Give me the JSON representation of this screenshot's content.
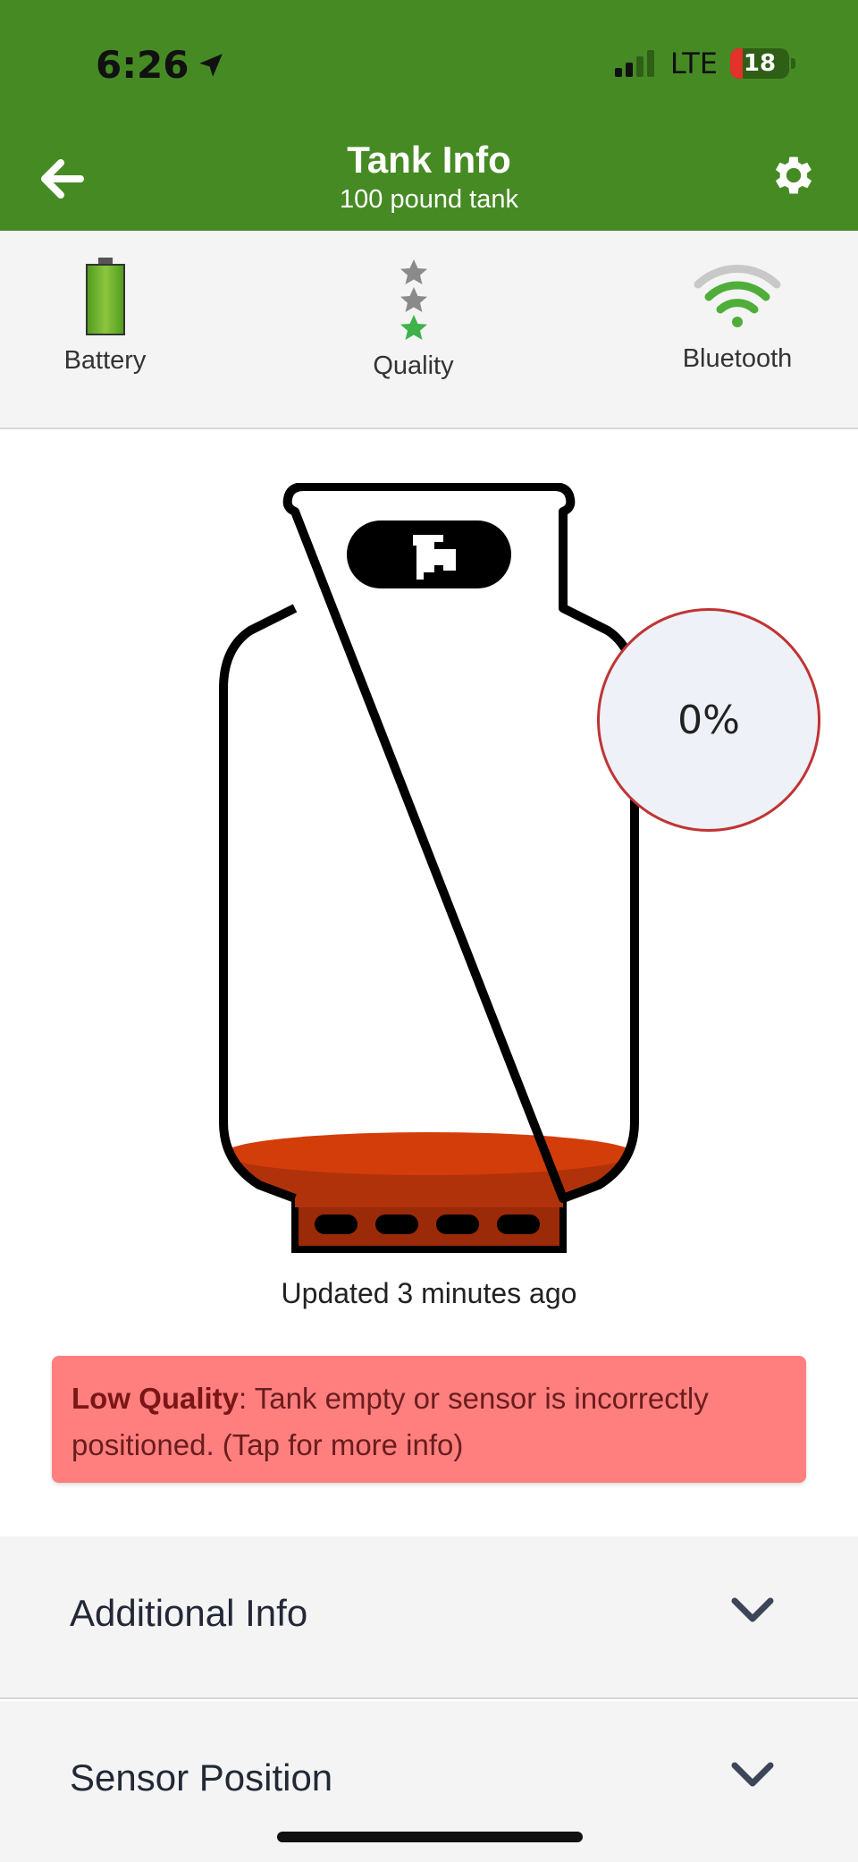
{
  "status_bar": {
    "time": "6:26",
    "network": "LTE",
    "battery_level": "18"
  },
  "header": {
    "title": "Tank Info",
    "subtitle": "100 pound tank"
  },
  "stats": {
    "battery_label": "Battery",
    "quality_label": "Quality",
    "quality_stars": {
      "filled": 1,
      "total": 3
    },
    "bluetooth_label": "Bluetooth"
  },
  "tank": {
    "fill_percent_label": "0%",
    "fill_level": 0.0
  },
  "updated_text": "Updated 3 minutes ago",
  "alert": {
    "title": "Low Quality",
    "message": ": Tank empty or sensor is incorrectly positioned. (Tap for more info)"
  },
  "accordions": [
    {
      "label": "Additional Info"
    },
    {
      "label": "Sensor Position"
    }
  ],
  "colors": {
    "header_green": "#468a24",
    "alert_red": "#ff7f7f",
    "propane_orange": "#d33d0a",
    "star_green": "#3fb24a",
    "star_gray": "#8a8a8a"
  }
}
